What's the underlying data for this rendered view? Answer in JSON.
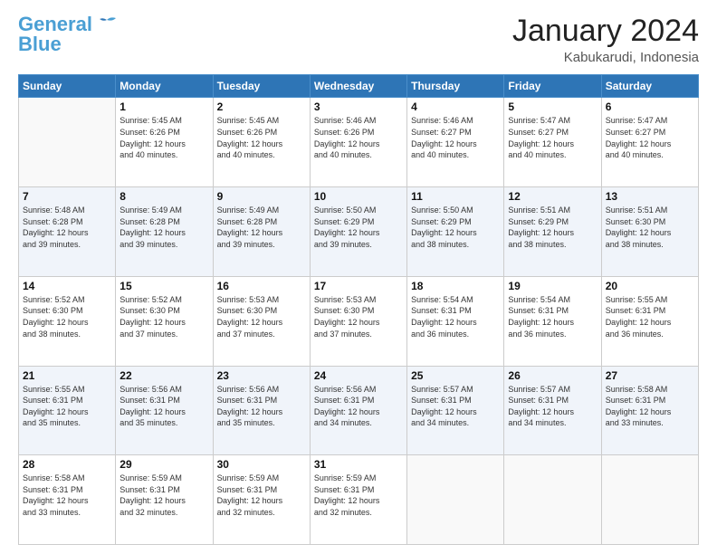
{
  "header": {
    "logo_line1": "General",
    "logo_line2": "Blue",
    "month_year": "January 2024",
    "location": "Kabukarudi, Indonesia"
  },
  "weekdays": [
    "Sunday",
    "Monday",
    "Tuesday",
    "Wednesday",
    "Thursday",
    "Friday",
    "Saturday"
  ],
  "weeks": [
    [
      {
        "num": "",
        "info": ""
      },
      {
        "num": "1",
        "info": "Sunrise: 5:45 AM\nSunset: 6:26 PM\nDaylight: 12 hours\nand 40 minutes."
      },
      {
        "num": "2",
        "info": "Sunrise: 5:45 AM\nSunset: 6:26 PM\nDaylight: 12 hours\nand 40 minutes."
      },
      {
        "num": "3",
        "info": "Sunrise: 5:46 AM\nSunset: 6:26 PM\nDaylight: 12 hours\nand 40 minutes."
      },
      {
        "num": "4",
        "info": "Sunrise: 5:46 AM\nSunset: 6:27 PM\nDaylight: 12 hours\nand 40 minutes."
      },
      {
        "num": "5",
        "info": "Sunrise: 5:47 AM\nSunset: 6:27 PM\nDaylight: 12 hours\nand 40 minutes."
      },
      {
        "num": "6",
        "info": "Sunrise: 5:47 AM\nSunset: 6:27 PM\nDaylight: 12 hours\nand 40 minutes."
      }
    ],
    [
      {
        "num": "7",
        "info": "Sunrise: 5:48 AM\nSunset: 6:28 PM\nDaylight: 12 hours\nand 39 minutes."
      },
      {
        "num": "8",
        "info": "Sunrise: 5:49 AM\nSunset: 6:28 PM\nDaylight: 12 hours\nand 39 minutes."
      },
      {
        "num": "9",
        "info": "Sunrise: 5:49 AM\nSunset: 6:28 PM\nDaylight: 12 hours\nand 39 minutes."
      },
      {
        "num": "10",
        "info": "Sunrise: 5:50 AM\nSunset: 6:29 PM\nDaylight: 12 hours\nand 39 minutes."
      },
      {
        "num": "11",
        "info": "Sunrise: 5:50 AM\nSunset: 6:29 PM\nDaylight: 12 hours\nand 38 minutes."
      },
      {
        "num": "12",
        "info": "Sunrise: 5:51 AM\nSunset: 6:29 PM\nDaylight: 12 hours\nand 38 minutes."
      },
      {
        "num": "13",
        "info": "Sunrise: 5:51 AM\nSunset: 6:30 PM\nDaylight: 12 hours\nand 38 minutes."
      }
    ],
    [
      {
        "num": "14",
        "info": "Sunrise: 5:52 AM\nSunset: 6:30 PM\nDaylight: 12 hours\nand 38 minutes."
      },
      {
        "num": "15",
        "info": "Sunrise: 5:52 AM\nSunset: 6:30 PM\nDaylight: 12 hours\nand 37 minutes."
      },
      {
        "num": "16",
        "info": "Sunrise: 5:53 AM\nSunset: 6:30 PM\nDaylight: 12 hours\nand 37 minutes."
      },
      {
        "num": "17",
        "info": "Sunrise: 5:53 AM\nSunset: 6:30 PM\nDaylight: 12 hours\nand 37 minutes."
      },
      {
        "num": "18",
        "info": "Sunrise: 5:54 AM\nSunset: 6:31 PM\nDaylight: 12 hours\nand 36 minutes."
      },
      {
        "num": "19",
        "info": "Sunrise: 5:54 AM\nSunset: 6:31 PM\nDaylight: 12 hours\nand 36 minutes."
      },
      {
        "num": "20",
        "info": "Sunrise: 5:55 AM\nSunset: 6:31 PM\nDaylight: 12 hours\nand 36 minutes."
      }
    ],
    [
      {
        "num": "21",
        "info": "Sunrise: 5:55 AM\nSunset: 6:31 PM\nDaylight: 12 hours\nand 35 minutes."
      },
      {
        "num": "22",
        "info": "Sunrise: 5:56 AM\nSunset: 6:31 PM\nDaylight: 12 hours\nand 35 minutes."
      },
      {
        "num": "23",
        "info": "Sunrise: 5:56 AM\nSunset: 6:31 PM\nDaylight: 12 hours\nand 35 minutes."
      },
      {
        "num": "24",
        "info": "Sunrise: 5:56 AM\nSunset: 6:31 PM\nDaylight: 12 hours\nand 34 minutes."
      },
      {
        "num": "25",
        "info": "Sunrise: 5:57 AM\nSunset: 6:31 PM\nDaylight: 12 hours\nand 34 minutes."
      },
      {
        "num": "26",
        "info": "Sunrise: 5:57 AM\nSunset: 6:31 PM\nDaylight: 12 hours\nand 34 minutes."
      },
      {
        "num": "27",
        "info": "Sunrise: 5:58 AM\nSunset: 6:31 PM\nDaylight: 12 hours\nand 33 minutes."
      }
    ],
    [
      {
        "num": "28",
        "info": "Sunrise: 5:58 AM\nSunset: 6:31 PM\nDaylight: 12 hours\nand 33 minutes."
      },
      {
        "num": "29",
        "info": "Sunrise: 5:59 AM\nSunset: 6:31 PM\nDaylight: 12 hours\nand 32 minutes."
      },
      {
        "num": "30",
        "info": "Sunrise: 5:59 AM\nSunset: 6:31 PM\nDaylight: 12 hours\nand 32 minutes."
      },
      {
        "num": "31",
        "info": "Sunrise: 5:59 AM\nSunset: 6:31 PM\nDaylight: 12 hours\nand 32 minutes."
      },
      {
        "num": "",
        "info": ""
      },
      {
        "num": "",
        "info": ""
      },
      {
        "num": "",
        "info": ""
      }
    ]
  ]
}
